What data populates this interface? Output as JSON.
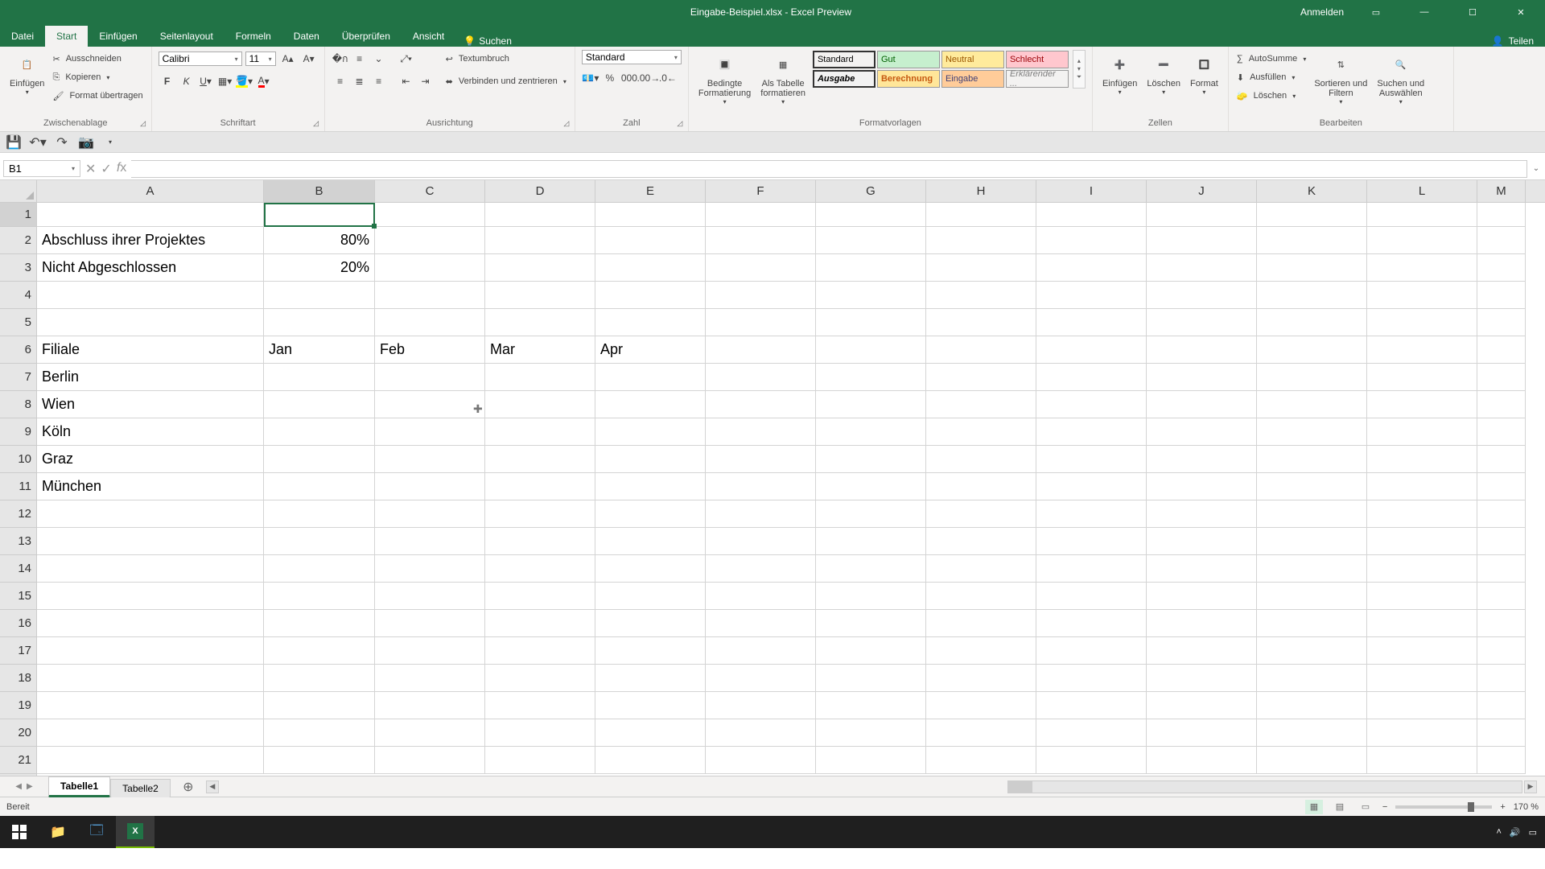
{
  "title": "Eingabe-Beispiel.xlsx - Excel Preview",
  "account": "Anmelden",
  "share": "Teilen",
  "menu": {
    "file": "Datei",
    "tabs": [
      "Start",
      "Einfügen",
      "Seitenlayout",
      "Formeln",
      "Daten",
      "Überprüfen",
      "Ansicht"
    ],
    "search": "Suchen"
  },
  "ribbon": {
    "clipboard": {
      "label": "Zwischenablage",
      "paste": "Einfügen",
      "cut": "Ausschneiden",
      "copy": "Kopieren",
      "format_painter": "Format übertragen"
    },
    "font": {
      "label": "Schriftart",
      "name": "Calibri",
      "size": "11"
    },
    "alignment": {
      "label": "Ausrichtung",
      "wrap": "Textumbruch",
      "merge": "Verbinden und zentrieren"
    },
    "number": {
      "label": "Zahl",
      "format": "Standard"
    },
    "styles": {
      "label": "Formatvorlagen",
      "cond": "Bedingte\nFormatierung",
      "table": "Als Tabelle\nformatieren",
      "standard": "Standard",
      "gut": "Gut",
      "neutral": "Neutral",
      "schlecht": "Schlecht",
      "ausgabe": "Ausgabe",
      "berechnung": "Berechnung",
      "eingabe": "Eingabe",
      "erklaerender": "Erklärender ..."
    },
    "cells": {
      "label": "Zellen",
      "insert": "Einfügen",
      "delete": "Löschen",
      "format": "Format"
    },
    "editing": {
      "label": "Bearbeiten",
      "autosum": "AutoSumme",
      "fill": "Ausfüllen",
      "clear": "Löschen",
      "sort": "Sortieren und\nFiltern",
      "find": "Suchen und\nAuswählen"
    }
  },
  "namebox": "B1",
  "columns": [
    "A",
    "B",
    "C",
    "D",
    "E",
    "F",
    "G",
    "H",
    "I",
    "J",
    "K",
    "L",
    "M"
  ],
  "row_numbers": [
    "1",
    "2",
    "3",
    "4",
    "5",
    "6",
    "7",
    "8",
    "9",
    "10",
    "11",
    "12",
    "13",
    "14",
    "15",
    "16",
    "17",
    "18",
    "19",
    "20",
    "21"
  ],
  "data": {
    "A2": "Abschluss ihrer Projektes",
    "B2": "80%",
    "A3": "Nicht Abgeschlossen",
    "B3": "20%",
    "A6": "Filiale",
    "B6": "Jan",
    "C6": "Feb",
    "D6": "Mar",
    "E6": "Apr",
    "A7": "Berlin",
    "A8": "Wien",
    "A9": "Köln",
    "A10": "Graz",
    "A11": "München"
  },
  "sheets": {
    "active": "Tabelle1",
    "other": "Tabelle2"
  },
  "status": "Bereit",
  "zoom": "170 %"
}
